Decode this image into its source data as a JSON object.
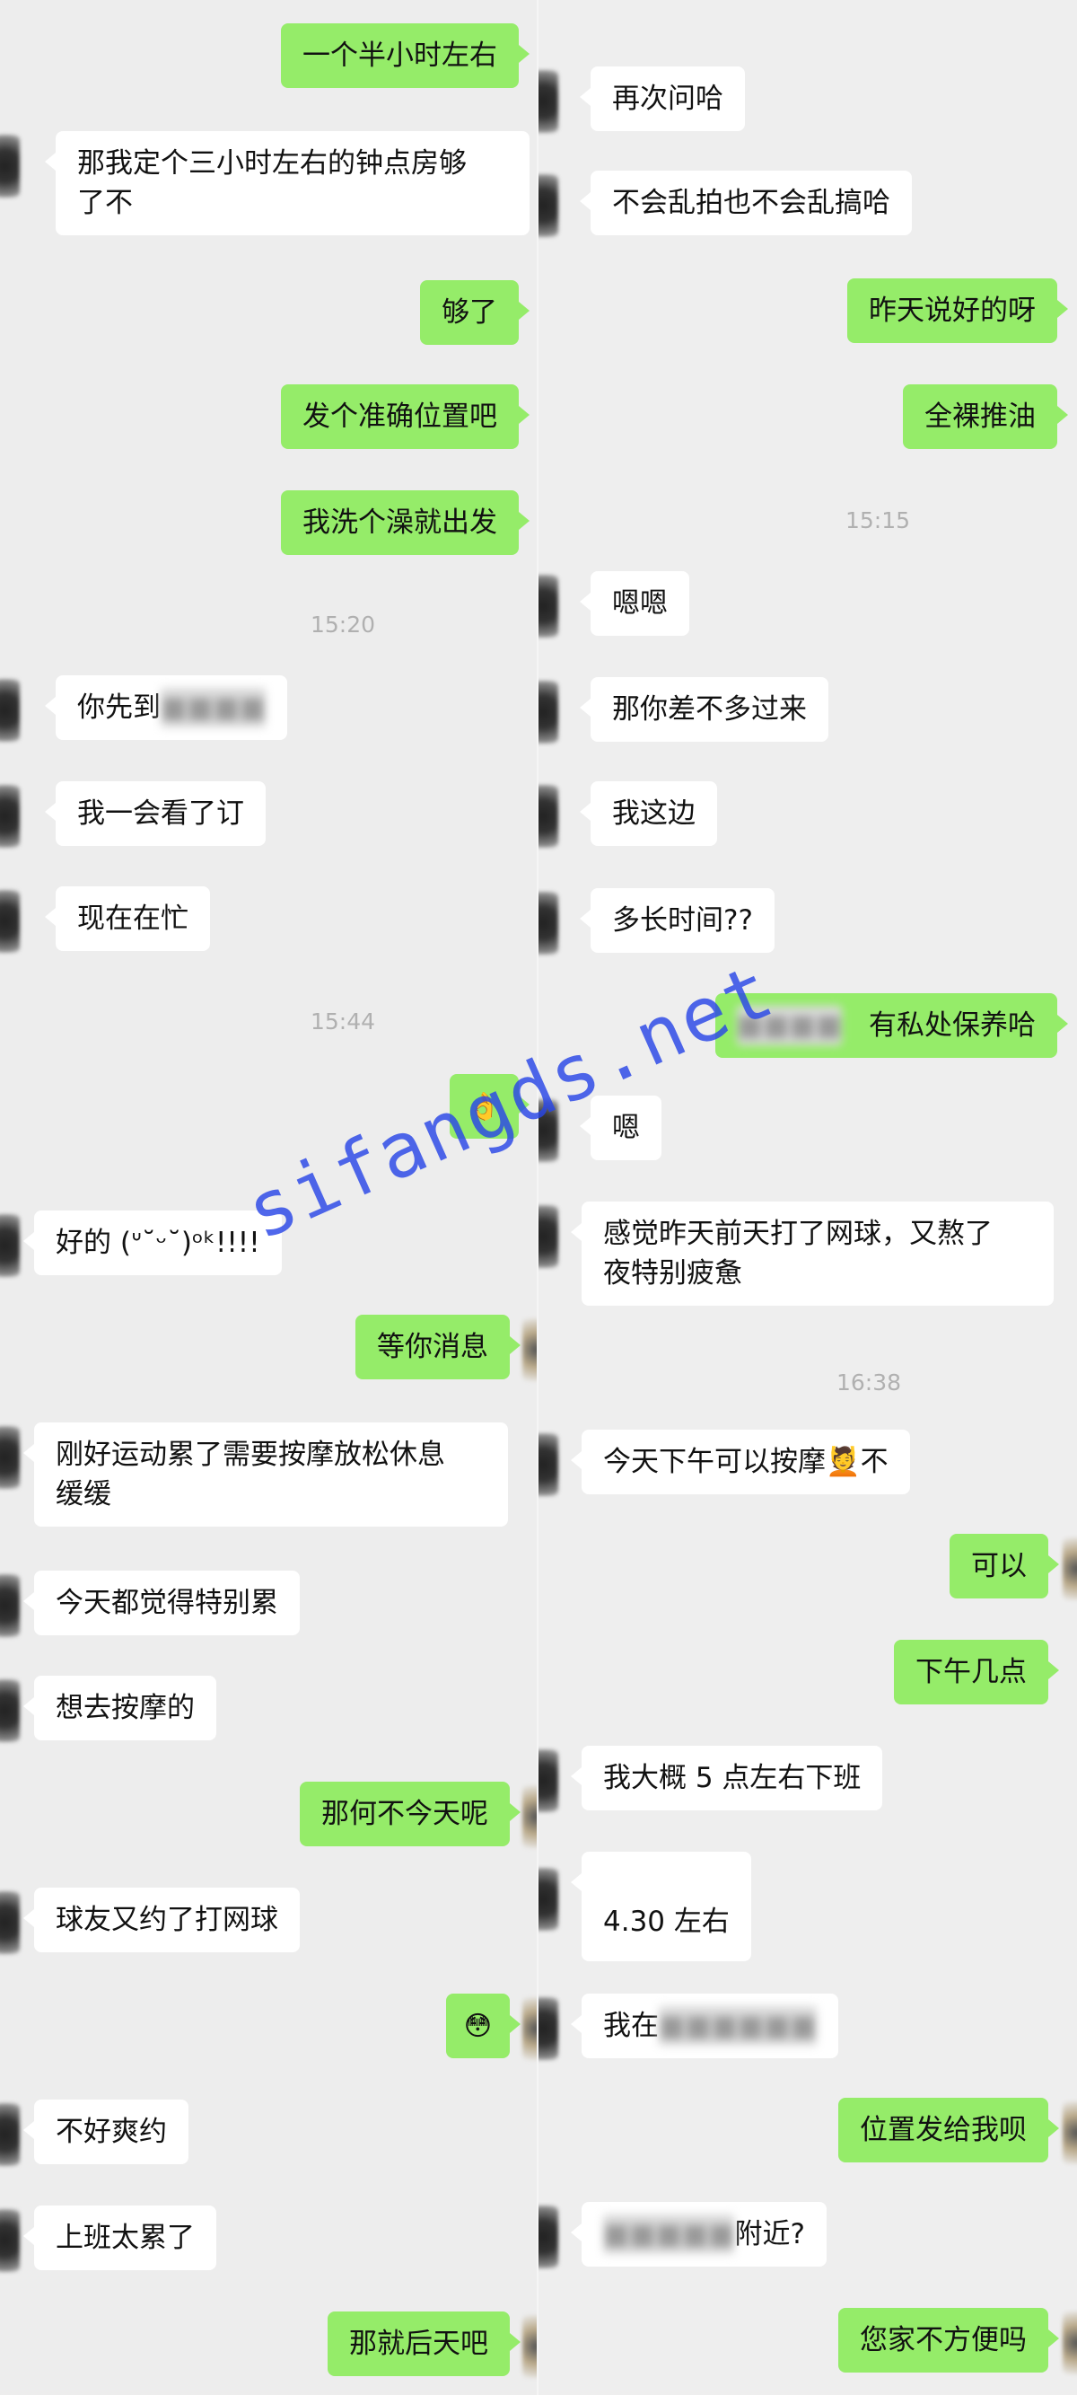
{
  "left_panel": {
    "messages": [
      {
        "dir": "out",
        "text": "一个半小时左右"
      },
      {
        "dir": "in",
        "text": "那我定个三小时左右的钟点房够\n了不"
      },
      {
        "dir": "out",
        "text": "够了"
      },
      {
        "dir": "out",
        "text": "发个准确位置吧"
      },
      {
        "dir": "out",
        "text": "我洗个澡就出发"
      },
      {
        "time": "15:20"
      },
      {
        "dir": "in",
        "text": "你先到",
        "blurred": "■■■■"
      },
      {
        "dir": "in",
        "text": "我一会看了订"
      },
      {
        "dir": "in",
        "text": "现在在忙"
      },
      {
        "time": "15:44"
      },
      {
        "dir": "out",
        "emoji": "👌"
      },
      {
        "dir": "in",
        "text": "好的 (ᐡ˘ᵕ˘)ᵒᵏ!!!!"
      },
      {
        "dir": "out",
        "text": "等你消息"
      },
      {
        "dir": "in",
        "text": "刚好运动累了需要按摩放松休息\n缓缓"
      },
      {
        "dir": "in",
        "text": "今天都觉得特别累"
      },
      {
        "dir": "in",
        "text": "想去按摩的"
      },
      {
        "dir": "out",
        "text": "那何不今天呢"
      },
      {
        "dir": "in",
        "text": "球友又约了打网球"
      },
      {
        "dir": "out",
        "emoji": "😳"
      },
      {
        "dir": "in",
        "text": "不好爽约"
      },
      {
        "dir": "in",
        "text": "上班太累了"
      },
      {
        "dir": "out",
        "text": "那就后天吧"
      }
    ]
  },
  "right_panel": {
    "messages": [
      {
        "dir": "in",
        "text": "再次问哈"
      },
      {
        "dir": "in",
        "text": "不会乱拍也不会乱搞哈"
      },
      {
        "dir": "out",
        "text": "昨天说好的呀"
      },
      {
        "dir": "out",
        "text": "全裸推油"
      },
      {
        "time": "15:15"
      },
      {
        "dir": "in",
        "text": "嗯嗯"
      },
      {
        "dir": "in",
        "text": "那你差不多过来"
      },
      {
        "dir": "in",
        "text": "我这边"
      },
      {
        "dir": "in",
        "text": "多长时间??"
      },
      {
        "dir": "out",
        "text": "有私处保养哈",
        "blurred": "■■■■"
      },
      {
        "dir": "in",
        "text": "嗯"
      },
      {
        "dir": "in",
        "text": "感觉昨天前天打了网球，又熬了\n夜特别疲惫"
      },
      {
        "time": "16:38"
      },
      {
        "dir": "in",
        "text": "今天下午可以按摩💆不"
      },
      {
        "dir": "out",
        "text": "可以"
      },
      {
        "dir": "out",
        "text": "下午几点"
      },
      {
        "dir": "in",
        "text": "我大概 5 点左右下班"
      },
      {
        "dir": "in",
        "text": "4.30 左右"
      },
      {
        "dir": "in",
        "text": "我在",
        "blurred": "■■■■■■"
      },
      {
        "dir": "out",
        "text": "位置发给我呗"
      },
      {
        "dir": "in",
        "text": "附近?",
        "blurred_prefix": "■■■■■"
      },
      {
        "dir": "out",
        "text": "您家不方便吗"
      }
    ]
  },
  "watermark": "sifangds.net",
  "colors": {
    "outgoing": "#95ec69",
    "incoming": "#ffffff",
    "background": "#ededed",
    "timestamp": "#b0b0b0"
  }
}
